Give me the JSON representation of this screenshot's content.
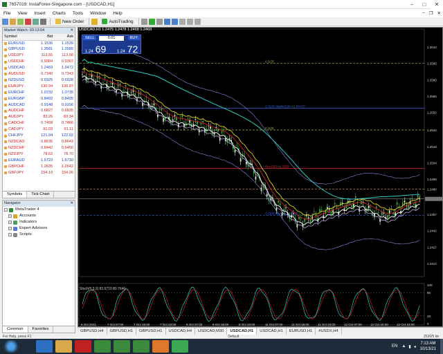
{
  "window": {
    "title": "7657019: InstaForex-Singapore.com - [USDCAD,H1]"
  },
  "menu": [
    "File",
    "View",
    "Insert",
    "Charts",
    "Tools",
    "Window",
    "Help"
  ],
  "toolbar": {
    "new_order": "New Order",
    "autotrading": "AutoTrading"
  },
  "market_watch": {
    "header": "Market Watch: 03:13:04",
    "columns": [
      "Symbol",
      "Bid",
      "Ask"
    ],
    "rows": [
      {
        "s": "EURUSD",
        "bid": "1.1536",
        "ask": "1.1539",
        "c": "b"
      },
      {
        "s": "GBPUSD",
        "bid": "1.3581",
        "ask": "1.3585",
        "c": "b"
      },
      {
        "s": "USDJPY",
        "bid": "113.55",
        "ask": "113.58",
        "c": "r"
      },
      {
        "s": "USDCHF",
        "bid": "0.9304",
        "ask": "0.9307",
        "c": "r"
      },
      {
        "s": "USDCAD",
        "bid": "1.2469",
        "ask": "1.2472",
        "c": "b"
      },
      {
        "s": "AUDUSD",
        "bid": "0.7340",
        "ask": "0.7343",
        "c": "r"
      },
      {
        "s": "NZDUSD",
        "bid": "0.6925",
        "ask": "0.6928",
        "c": "b"
      },
      {
        "s": "EURJPY",
        "bid": "130.94",
        "ask": "130.97",
        "c": "r"
      },
      {
        "s": "EURCHF",
        "bid": "1.0732",
        "ask": "1.0735",
        "c": "b"
      },
      {
        "s": "EURGBP",
        "bid": "0.8492",
        "ask": "0.8495",
        "c": "b"
      },
      {
        "s": "AUDCAD",
        "bid": "0.9148",
        "ask": "0.9156",
        "c": "b"
      },
      {
        "s": "AUDCHF",
        "bid": "0.6827",
        "ask": "0.6835",
        "c": "r"
      },
      {
        "s": "AUDJPY",
        "bid": "83.26",
        "ask": "83.34",
        "c": "r"
      },
      {
        "s": "CADCHF",
        "bid": "0.7458",
        "ask": "0.7466",
        "c": "r"
      },
      {
        "s": "CADJPY",
        "bid": "91.03",
        "ask": "91.11",
        "c": "r"
      },
      {
        "s": "CHFJPY",
        "bid": "121.94",
        "ask": "122.02",
        "c": "b"
      },
      {
        "s": "NZDCAD",
        "bid": "0.8635",
        "ask": "0.8643",
        "c": "r"
      },
      {
        "s": "NZDCHF",
        "bid": "0.6442",
        "ask": "0.6450",
        "c": "r"
      },
      {
        "s": "NZDJPY",
        "bid": "78.62",
        "ask": "78.70",
        "c": "r"
      },
      {
        "s": "EURAUD",
        "bid": "1.5723",
        "ask": "1.5730",
        "c": "b"
      },
      {
        "s": "GBPCHF",
        "bid": "1.2635",
        "ask": "1.2642",
        "c": "r"
      },
      {
        "s": "GBPJPY",
        "bid": "154.19",
        "ask": "154.26",
        "c": "r"
      }
    ],
    "tabs": [
      "Symbols",
      "Tick Chart"
    ]
  },
  "navigator": {
    "header": "Navigator",
    "items": [
      "MetaTrader 4",
      "Accounts",
      "Indicators",
      "Expert Advisors",
      "Scripts"
    ],
    "tabs": [
      "Common",
      "Favorites"
    ]
  },
  "chart": {
    "title": "USDCAD,H1  1.2475 1.2478 1.2468 1.2469",
    "one_click": {
      "sell": "SELL",
      "buy": "BUY",
      "lot": "0.01",
      "sell_small": "1.24",
      "sell_big": "69",
      "buy_small": "1.24",
      "buy_big": "72"
    },
    "levels": [
      {
        "label": "0 [1/3]",
        "price": 1.2595,
        "color": "#9bbf3a"
      },
      {
        "label": "Q [2/3] HighM [30] H1 PIVOT",
        "price": 1.2554,
        "color": "#3a66d8"
      },
      {
        "label": "0 [1/3]",
        "price": 1.2534,
        "color": "#9bbf3a"
      },
      {
        "label": "Res [30] H1 [3/3]",
        "price": 1.2499,
        "color": "#d03030"
      },
      {
        "label": "",
        "price": 1.248,
        "color": "#e0a030"
      },
      {
        "label": "",
        "price": 1.2471,
        "color": "#888"
      },
      {
        "label": "Q [3/3] HASUP H1 SUP",
        "price": 1.2456,
        "color": "#3a66d8"
      }
    ],
    "price_axis": [
      "1.2610",
      "1.2595",
      "1.2580",
      "1.2565",
      "1.2550",
      "1.2534",
      "1.2519",
      "1.2504",
      "1.2489",
      "1.2480",
      "1.2471",
      "1.2457",
      "1.2442",
      "1.2427",
      "1.2412"
    ],
    "time_axis": [
      "6 Oct 2021",
      "7 Oct 07:00",
      "7 Oct 15:00",
      "7 Oct 23:00",
      "8 Oct 07:00",
      "8 Oct 15:00",
      "8 Oct 23:00",
      "11 Oct 07:00",
      "11 Oct 15:00",
      "11 Oct 23:00",
      "12 Oct 07:00",
      "12 Oct 15:00",
      "12 Oct 23:00"
    ],
    "stoch_label": "Stoch(5,3,3) 83.6710 80.7646",
    "stoch_axis": [
      "100",
      "80",
      "20",
      "0"
    ]
  },
  "bottom_tabs": [
    "GBPUSD,H4",
    "GBPUSD,H1",
    "GBPUSD,H1",
    "USDCAD,H4",
    "USDCAD,M30",
    "USDCAD,H1",
    "USDCAD,H1",
    "EURUSD,H1",
    "#USDX,H4"
  ],
  "active_tab_index": 5,
  "status": {
    "help": "For Help, press F1",
    "profile": "Default",
    "traffic": "2520/5 kb"
  },
  "taskbar": {
    "lang": "EN",
    "time": "7:13 AM",
    "date": "10/13/21"
  }
}
